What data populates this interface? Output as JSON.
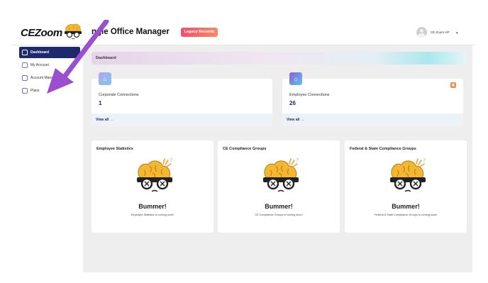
{
  "header": {
    "logo_text": "CEZoom",
    "app_title": "ngle Office Manager",
    "legacy_button": "Legacy Records",
    "user_name": "CE Zoom HP",
    "caret": "▾"
  },
  "sidebar": {
    "items": [
      {
        "label": "Dashboard",
        "icon": "home-icon",
        "active": true
      },
      {
        "label": "My Account",
        "icon": "user-icon",
        "active": false
      },
      {
        "label": "Account Mana",
        "icon": "network-icon",
        "active": false
      },
      {
        "label": "Plans",
        "icon": "plans-icon",
        "active": false
      }
    ]
  },
  "breadcrumb": "Dashboard",
  "stats": [
    {
      "label": "Corporate Connections",
      "value": "1",
      "view_all": "View all →",
      "icon": "corporate-icon",
      "color": "#8fb0ee"
    },
    {
      "label": "Employee Connections",
      "value": "26",
      "view_all": "View all →",
      "icon": "employee-icon",
      "color": "#7b6fd6"
    }
  ],
  "panels": [
    {
      "title": "Employee Statistics",
      "heading": "Bummer!",
      "message": "Employee Statistics is coming soon!"
    },
    {
      "title": "CE Compliance Groups",
      "heading": "Bummer!",
      "message": "CE Compliance Groups is coming soon!"
    },
    {
      "title": "Federal & State Compliance Groups",
      "heading": "Bummer!",
      "message": "Federal & State Compliance Groups is coming soon!"
    }
  ],
  "colors": {
    "navy": "#1d2a6b",
    "arrow": "#9b4fd0",
    "legacy": "#f24d6c"
  }
}
